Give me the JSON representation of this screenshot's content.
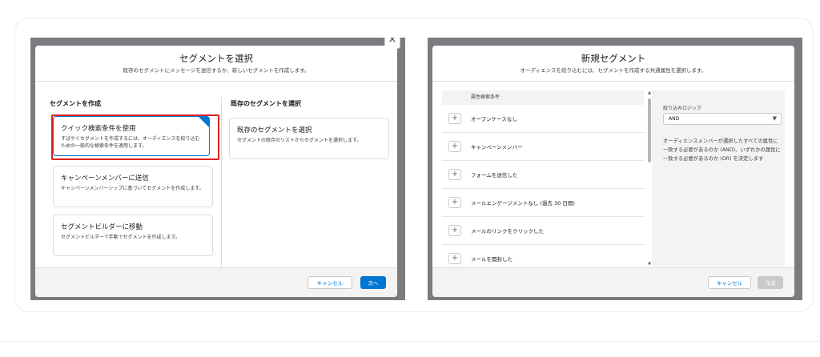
{
  "left_dialog": {
    "title": "セグメントを選択",
    "subtitle": "既存のセグメントにメッセージを送信するか、新しいセグメントを作成します。",
    "create_heading": "セグメントを作成",
    "existing_heading": "既存のセグメントを選択",
    "tiles": [
      {
        "title": "クイック検索条件を使用",
        "desc": "すばやくセグメントを作成するには、オーディエンスを絞り込むための一般的な検索条件を適用します。",
        "selected": true
      },
      {
        "title": "キャンペーンメンバーに送信",
        "desc": "キャンペーンメンバーシップに基づいてセグメントを作成します。",
        "selected": false
      },
      {
        "title": "セグメントビルダーに移動",
        "desc": "セグメントビルダーで手動でセグメントを作成します。",
        "selected": false
      }
    ],
    "existing_tile": {
      "title": "既存のセグメントを選択",
      "desc": "セグメントの既存のリストからセグメントを選択します。"
    },
    "cancel_label": "キャンセル",
    "next_label": "次へ",
    "close_glyph": "×"
  },
  "right_dialog": {
    "title": "新規セグメント",
    "subtitle": "オーディエンスを絞り込むには、セグメントを作成する共通属性を選択します。",
    "list_header": "属性検索条件",
    "attributes": [
      "オープンケースなし",
      "キャンペーンメンバー",
      "フォームを送信した",
      "メールエンゲージメントなし (過去 30 日間)",
      "メールのリンクをクリックした",
      "メールを開封した"
    ],
    "logic_label": "絞り込みロジック",
    "logic_value": "AND",
    "logic_description": "オーディエンスメンバーが選択したすべての属性に一致する必要があるのか (AND)、いずれかの属性に一致する必要があるのか (OR) を決定します",
    "cancel_label": "キャンセル",
    "create_label": "作成"
  },
  "colors": {
    "brand": "#0176d3",
    "highlight": "#e02020",
    "overlay": "#7a7c80"
  }
}
